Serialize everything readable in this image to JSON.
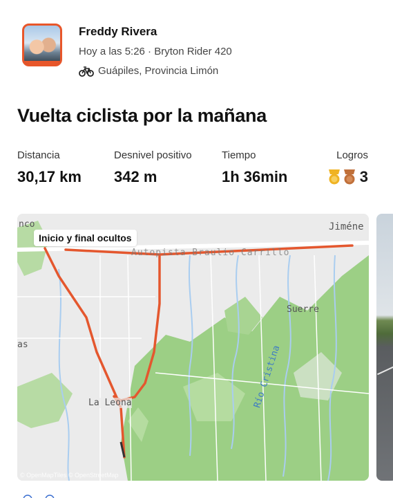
{
  "athlete": {
    "name": "Freddy Rivera",
    "meta": "Hoy a las 5:26 · Bryton Rider 420",
    "location": "Guápiles, Provincia Limón",
    "location_icon": "bike-icon",
    "avatar_border_color": "#e8562a"
  },
  "activity": {
    "title": "Vuelta ciclista por la mañana"
  },
  "stats": [
    {
      "label": "Distancia",
      "value": "30,17 km"
    },
    {
      "label": "Desnivel positivo",
      "value": "342 m"
    },
    {
      "label": "Tiempo",
      "value": "1h 36min"
    }
  ],
  "achievements": {
    "label": "Logros",
    "count": "3",
    "medals": [
      {
        "icon": "gold-medal-icon",
        "color": "#f0b323"
      },
      {
        "icon": "bronze-medal-icon",
        "color": "#c0703a"
      }
    ]
  },
  "map": {
    "route_label": "Inicio y final ocultos",
    "route_color": "#e4572e",
    "places": {
      "top_left": "nco",
      "top_right": "Jiméne",
      "road": "Autopista Braulio Carrillo",
      "suerre": "Suerre",
      "left": "as",
      "la_leona": "La Leona",
      "river": "Río Cristina"
    },
    "attribution": "© OpenMapTiles © OpenStreetMap"
  }
}
